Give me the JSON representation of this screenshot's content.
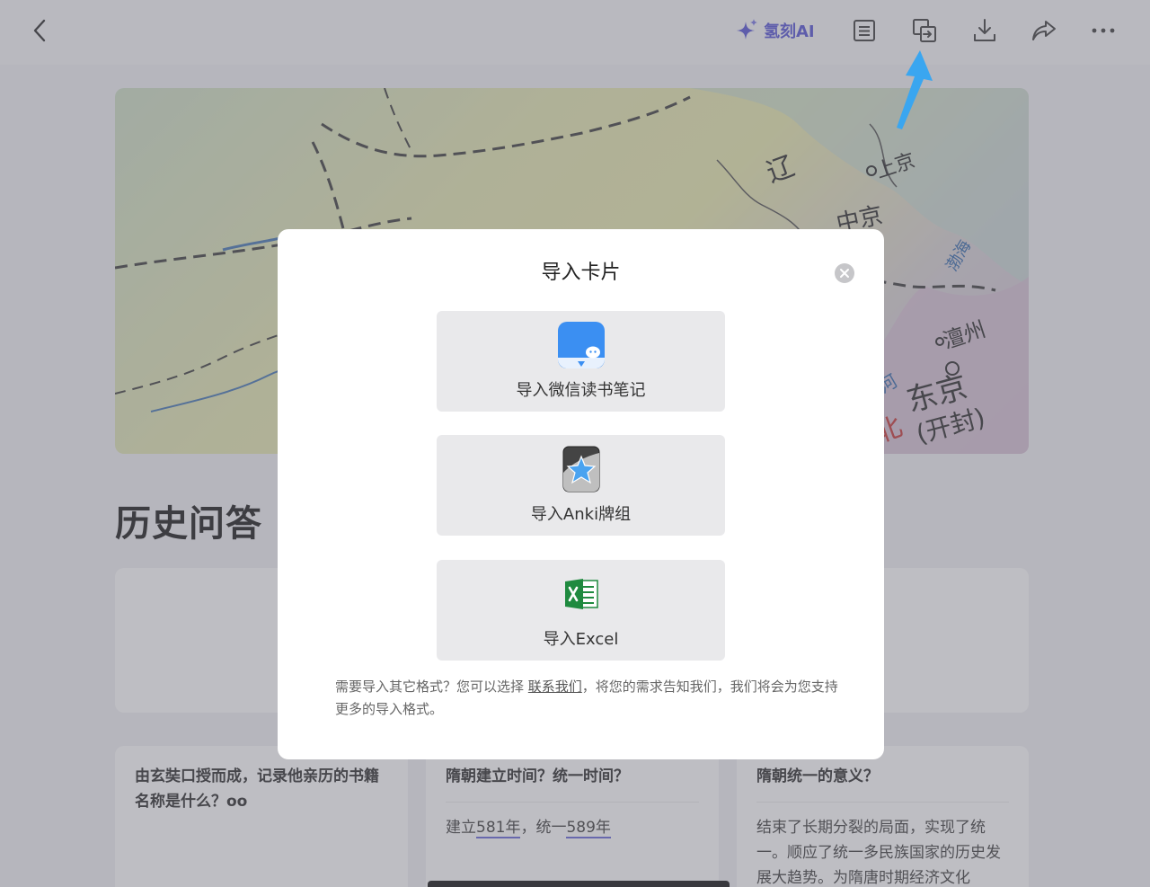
{
  "topbar": {
    "ai_label": "氢刻AI",
    "icons": [
      "back-icon",
      "sparkle-icon",
      "list-icon",
      "import-icon",
      "download-icon",
      "share-icon",
      "more-icon"
    ]
  },
  "page": {
    "map_labels": [
      "辽",
      "上京",
      "中京",
      "渤海",
      "澶州",
      "东京",
      "(开封)",
      "河",
      "北"
    ],
    "title": "历史问答",
    "cards": [
      {
        "question": "由玄奘口授而成，记录他亲历的书籍名称是什么？oo",
        "answer": ""
      },
      {
        "question": "隋朝建立时间？统一时间？",
        "answer_parts": [
          "建立",
          "581年",
          "，统一",
          "589年"
        ]
      },
      {
        "question": "隋朝统一的意义？",
        "answer": "结束了长期分裂的局面，实现了统一。顺应了统一多民族国家的历史发展大趋势。为隋唐时期经济文化"
      }
    ]
  },
  "modal": {
    "title": "导入卡片",
    "options": [
      {
        "label": "导入微信读书笔记",
        "icon": "weread-icon"
      },
      {
        "label": "导入Anki牌组",
        "icon": "anki-icon"
      },
      {
        "label": "导入Excel",
        "icon": "excel-icon"
      }
    ],
    "note_before": "需要导入其它格式？您可以选择 ",
    "note_link": "联系我们",
    "note_after": "，将您的需求告知我们，我们将会为您支持更多的导入格式。"
  },
  "colors": {
    "accent": "#5b59d6",
    "arrow": "#3aa6f0",
    "excel_green": "#1f8a3f",
    "weread_blue": "#3b8ff2"
  }
}
